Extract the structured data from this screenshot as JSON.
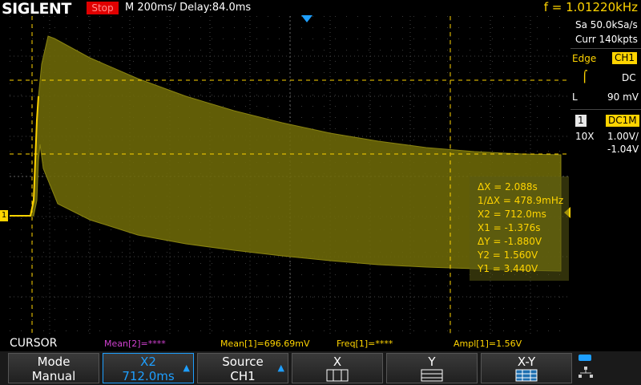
{
  "header": {
    "logo": "SIGLENT",
    "run_state": "Stop",
    "timebase": "M 200ms/  Delay:84.0ms",
    "frequency": "f = 1.01220kHz"
  },
  "right_panel": {
    "sample_rate": "Sa 50.0kSa/s",
    "memory": "Curr 140kpts",
    "trigger_type": "Edge",
    "trigger_source": "CH1",
    "trigger_coupling": "DC",
    "trigger_level_label": "L",
    "trigger_level": "90 mV",
    "channel_number": "1",
    "channel_coupling": "DC1M",
    "probe": "10X",
    "volts_div": "1.00V/",
    "offset": "-1.04V"
  },
  "cursor_readout": {
    "dx": "ΔX = 2.088s",
    "inv_dx": "1/ΔX = 478.9mHz",
    "x2": "X2 = 712.0ms",
    "x1": "X1 = -1.376s",
    "dy": "ΔY = -1.880V",
    "y2": "Y2 = 1.560V",
    "y1": "Y1 = 3.440V"
  },
  "status_row": {
    "menu_title": "CURSOR",
    "mean2": "Mean[2]=****",
    "mean1": "Mean[1]=696.69mV",
    "freq1": "Freq[1]=****",
    "ampl1": "Ampl[1]=1.56V"
  },
  "softkeys": [
    {
      "label": "Mode",
      "value": "Manual"
    },
    {
      "label": "X2",
      "value": "712.0ms"
    },
    {
      "label": "Source",
      "value": "CH1"
    },
    {
      "label": "X",
      "value": ""
    },
    {
      "label": "Y",
      "value": ""
    },
    {
      "label": "X-Y",
      "value": ""
    }
  ],
  "channel_marker": "1",
  "colors": {
    "ch1": "#ffd400",
    "accent": "#1e9fff",
    "stop": "#e00000"
  }
}
